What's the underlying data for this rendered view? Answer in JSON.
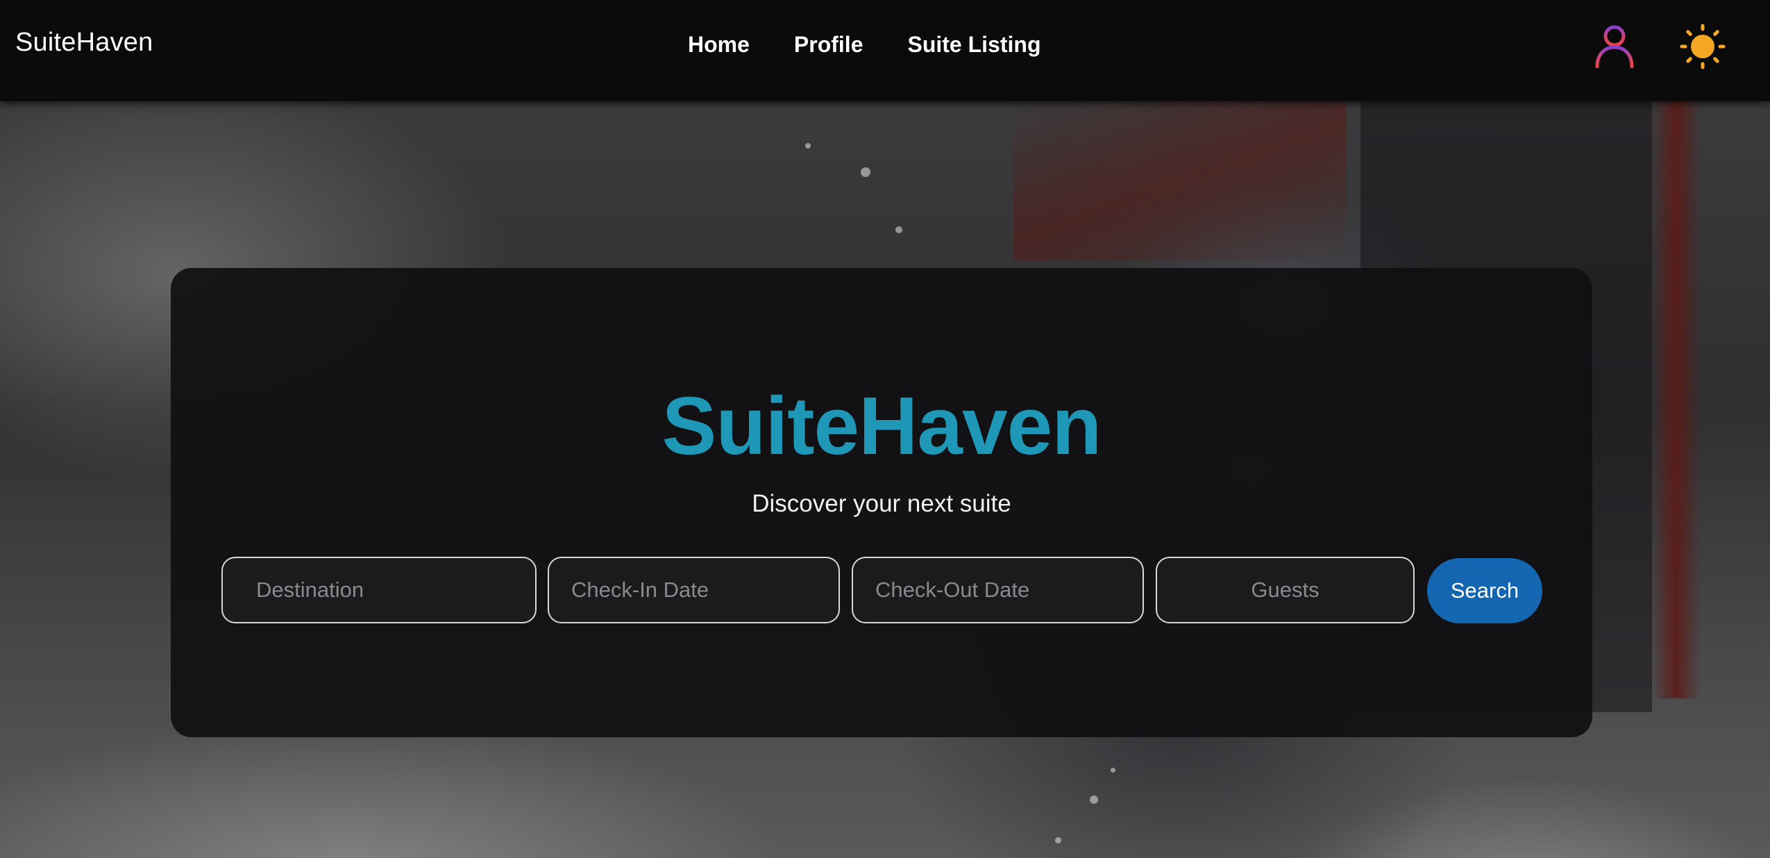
{
  "navbar": {
    "brand": "SuiteHaven",
    "links": [
      {
        "label": "Home"
      },
      {
        "label": "Profile"
      },
      {
        "label": "Suite Listing"
      }
    ],
    "icons": {
      "profile": "user-icon",
      "theme_toggle": "sun-icon"
    }
  },
  "hero": {
    "title": "SuiteHaven",
    "subtitle": "Discover your next suite"
  },
  "search": {
    "destination_placeholder": "Destination",
    "checkin_placeholder": "Check-In Date",
    "checkout_placeholder": "Check-Out Date",
    "guests_placeholder": "Guests",
    "button_label": "Search"
  },
  "colors": {
    "accent_title": "#1f98b8",
    "search_button": "#1466b0",
    "sun": "#f5a623",
    "user_icon_top": "#8a3fd1",
    "user_icon_bottom": "#e8424b"
  }
}
